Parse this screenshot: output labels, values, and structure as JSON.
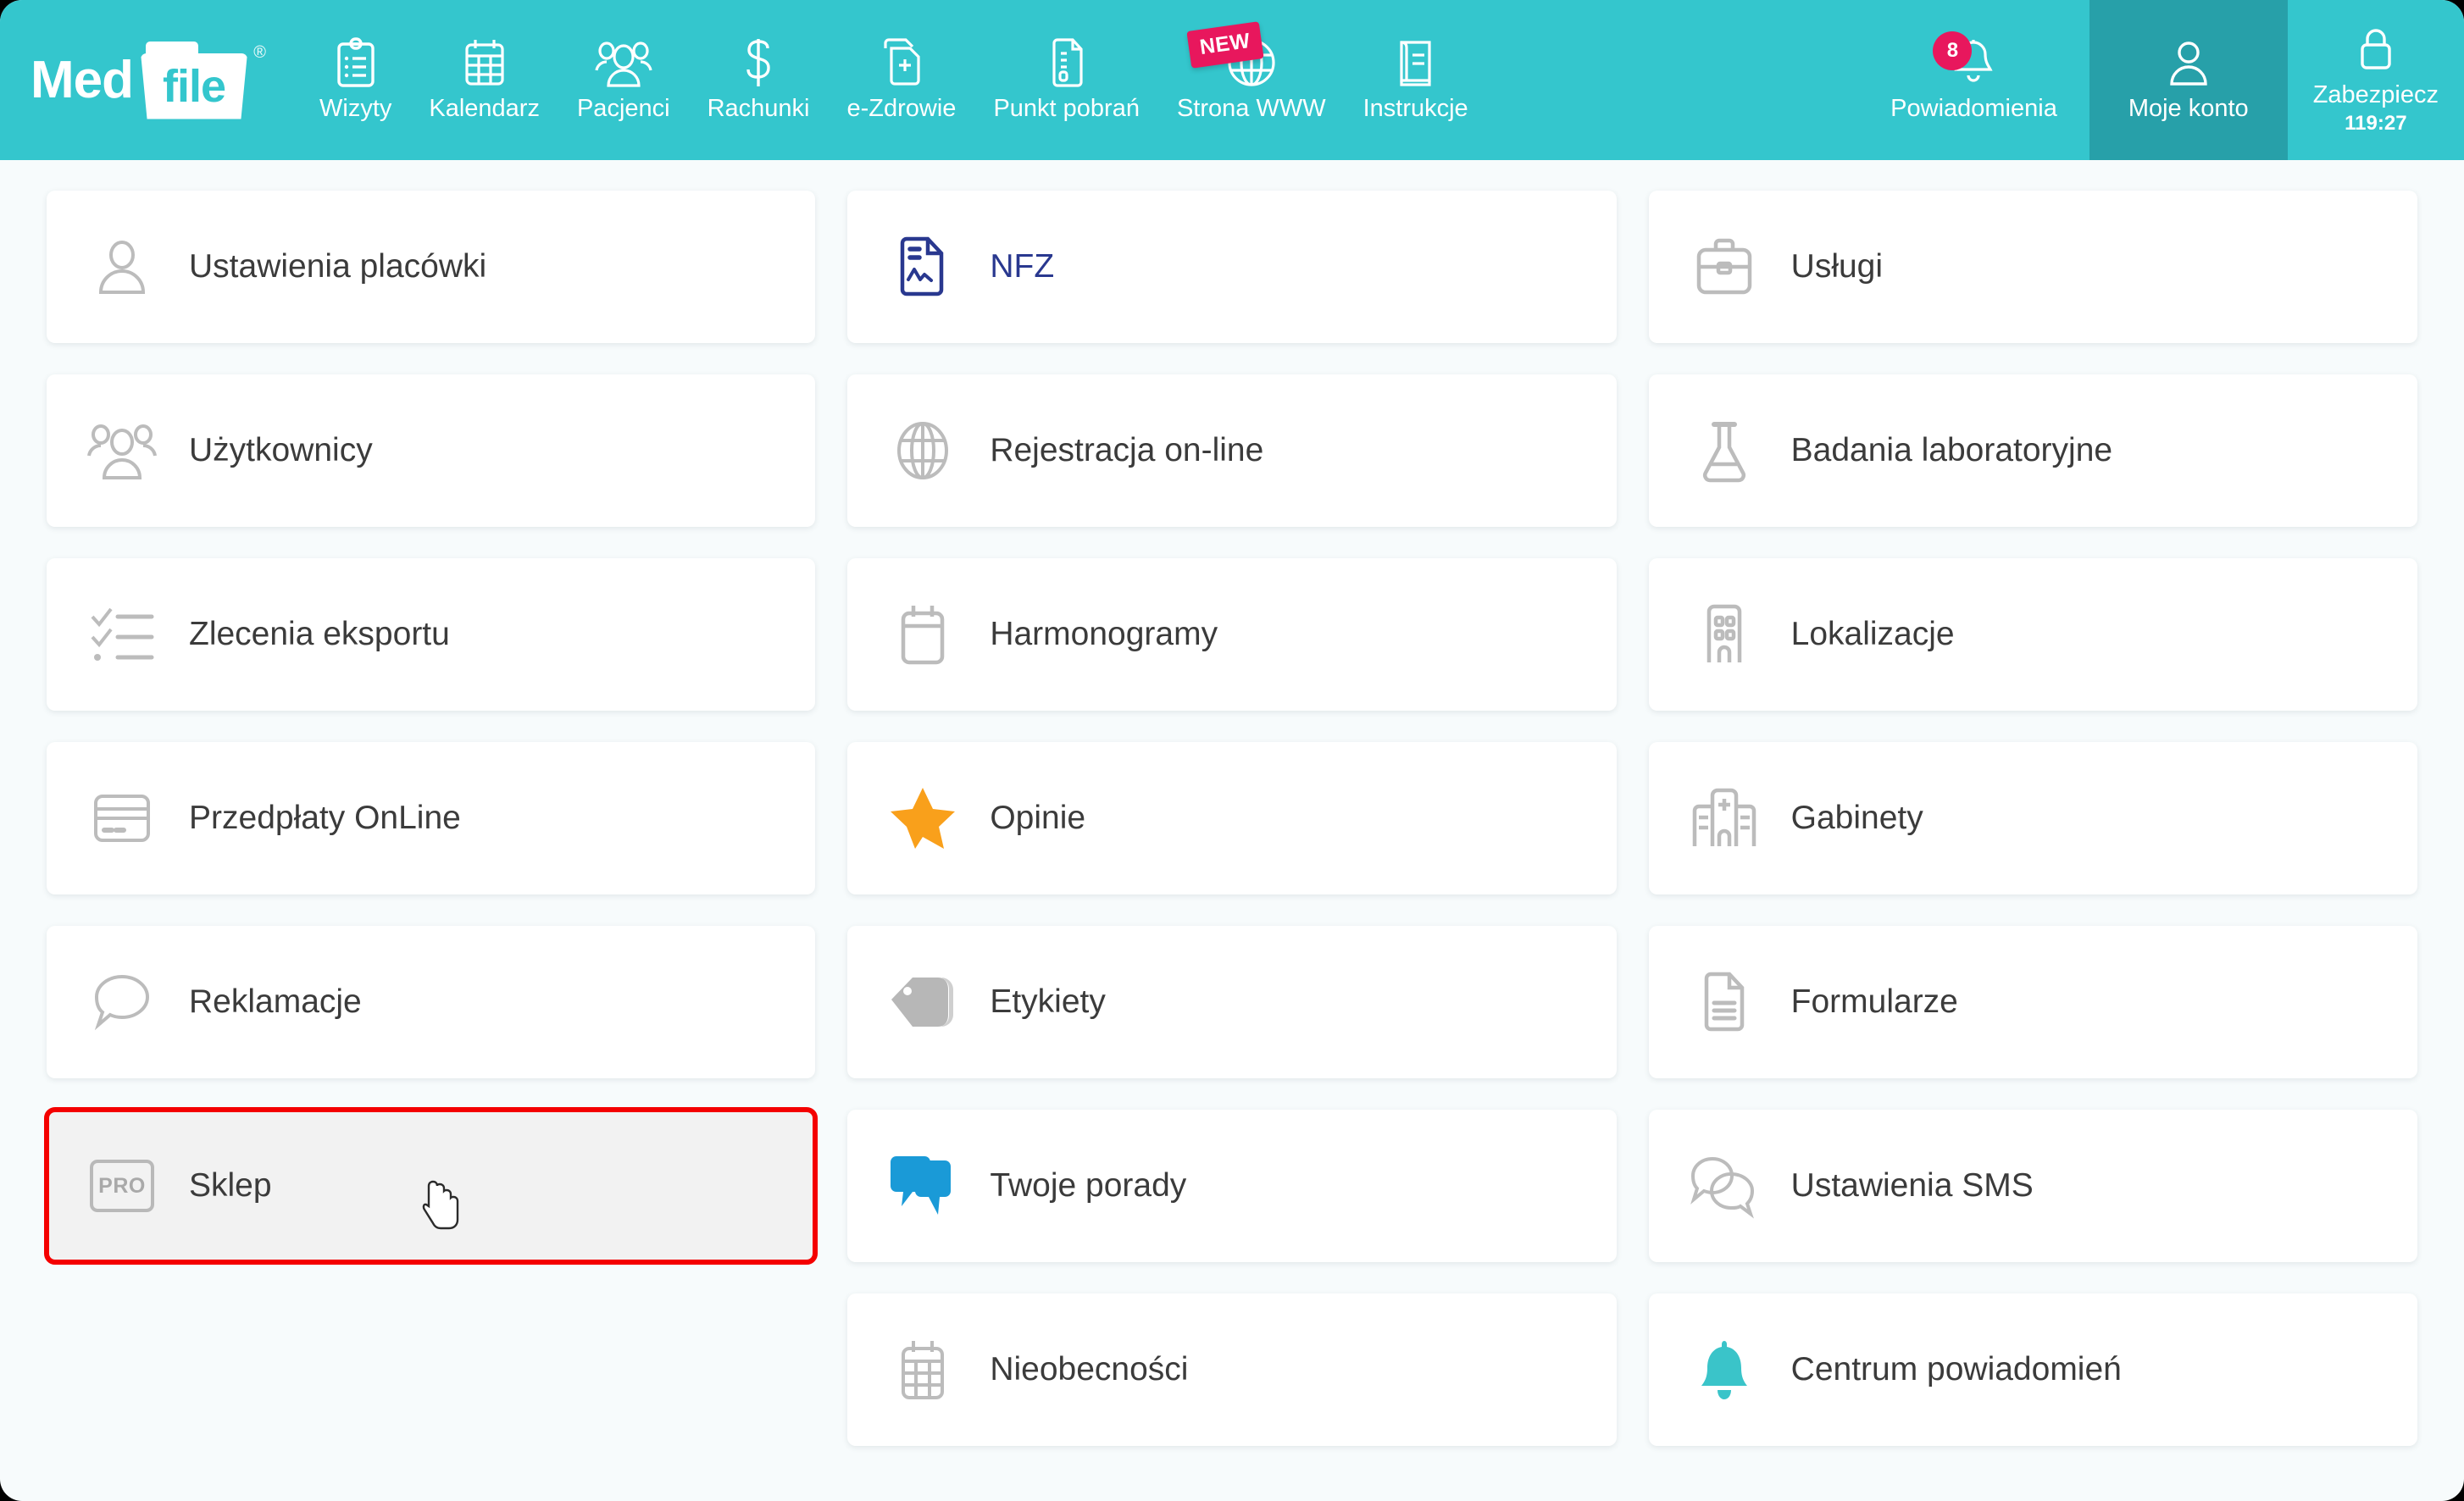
{
  "brand": {
    "word_left": "Med",
    "word_right": "file",
    "trademark": "®"
  },
  "nav": {
    "items": [
      {
        "label": "Wizyty",
        "icon": "clipboard-list-icon"
      },
      {
        "label": "Kalendarz",
        "icon": "calendar-grid-icon"
      },
      {
        "label": "Pacjenci",
        "icon": "people-group-icon"
      },
      {
        "label": "Rachunki",
        "icon": "dollar-sign-icon"
      },
      {
        "label": "e-Zdrowie",
        "icon": "medical-file-plus-icon"
      },
      {
        "label": "Punkt pobrań",
        "icon": "document-lines-icon"
      },
      {
        "label": "Strona WWW",
        "icon": "globe-icon",
        "badge": "NEW"
      },
      {
        "label": "Instrukcje",
        "icon": "book-icon"
      }
    ],
    "right": [
      {
        "label": "Powiadomienia",
        "icon": "bell-icon",
        "count": "8"
      },
      {
        "label": "Moje konto",
        "icon": "user-icon",
        "active": true
      },
      {
        "label": "Zabezpiecz",
        "icon": "lock-icon",
        "timer": "119:27"
      }
    ]
  },
  "colors": {
    "nav_bg": "#34c6cd",
    "nav_active_bg": "#27a0a9",
    "badge": "#e8175d",
    "page_bg": "#f7fbfc",
    "card_bg": "#ffffff",
    "highlight_border": "#f40000",
    "nfz_blue": "#29388f",
    "star_orange": "#f9a01b",
    "chat_blue": "#1a9ad7",
    "bell_teal": "#3ac4c9",
    "icon_grey": "#bcbcbc",
    "text": "#3b3b3b"
  },
  "grid": {
    "columns": [
      {
        "cards": [
          {
            "label": "Ustawienia placówki",
            "icon": "user-outline-icon"
          },
          {
            "label": "Użytkownicy",
            "icon": "users-group-outline-icon"
          },
          {
            "label": "Zlecenia eksportu",
            "icon": "checklist-icon"
          },
          {
            "label": "Przedpłaty OnLine",
            "icon": "credit-card-icon"
          },
          {
            "label": "Reklamacje",
            "icon": "speech-bubble-icon"
          },
          {
            "label": "Sklep",
            "icon": "pro-badge-icon",
            "highlighted": true,
            "pro": "PRO"
          }
        ]
      },
      {
        "cards": [
          {
            "label": "NFZ",
            "icon": "nfz-document-chart-icon",
            "label_color": "#29388f"
          },
          {
            "label": "Rejestracja on-line",
            "icon": "globe-outline-icon"
          },
          {
            "label": "Harmonogramy",
            "icon": "calendar-blank-icon"
          },
          {
            "label": "Opinie",
            "icon": "star-filled-icon"
          },
          {
            "label": "Etykiety",
            "icon": "tag-filled-icon"
          },
          {
            "label": "Twoje porady",
            "icon": "chat-bubbles-filled-icon"
          },
          {
            "label": "Nieobecności",
            "icon": "calendar-grid-outline-icon"
          }
        ]
      },
      {
        "cards": [
          {
            "label": "Usługi",
            "icon": "briefcase-icon"
          },
          {
            "label": "Badania laboratoryjne",
            "icon": "flask-icon"
          },
          {
            "label": "Lokalizacje",
            "icon": "building-icon"
          },
          {
            "label": "Gabinety",
            "icon": "hospital-icon"
          },
          {
            "label": "Formularze",
            "icon": "document-form-icon"
          },
          {
            "label": "Ustawienia SMS",
            "icon": "two-speech-bubbles-icon"
          },
          {
            "label": "Centrum powiadomień",
            "icon": "bell-filled-icon"
          }
        ]
      }
    ]
  },
  "cursor": {
    "type": "pointer-hand",
    "over": "Sklep"
  }
}
